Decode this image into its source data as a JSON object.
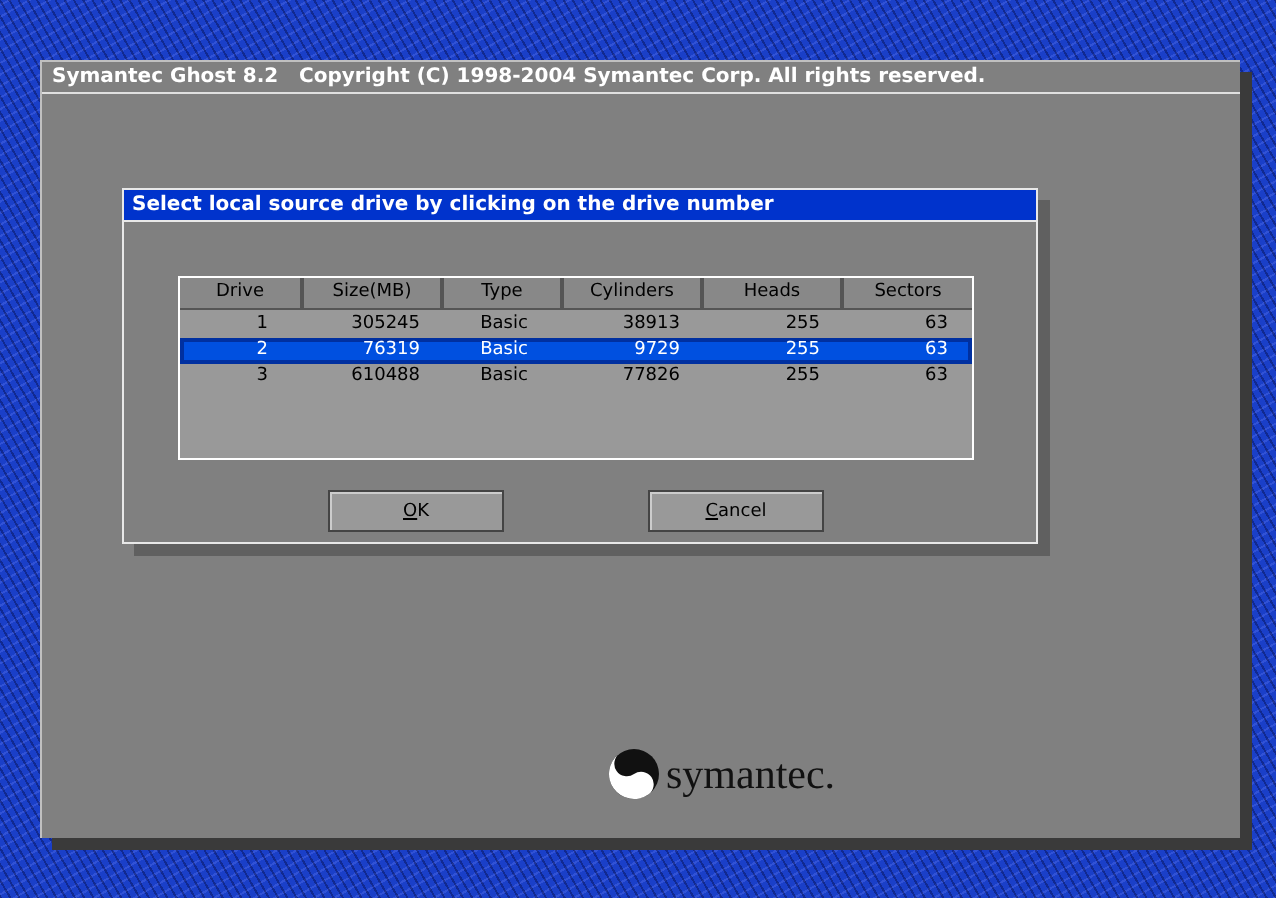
{
  "window": {
    "title": "Symantec Ghost 8.2   Copyright (C) 1998-2004 Symantec Corp. All rights reserved."
  },
  "dialog": {
    "title": "Select local source drive by clicking on the drive number",
    "table": {
      "columns": [
        "Drive",
        "Size(MB)",
        "Type",
        "Cylinders",
        "Heads",
        "Sectors"
      ],
      "rows": [
        {
          "cells": [
            "1",
            "305245",
            "Basic",
            "38913",
            "255",
            "63"
          ],
          "selected": false
        },
        {
          "cells": [
            "2",
            "76319",
            "Basic",
            "9729",
            "255",
            "63"
          ],
          "selected": true
        },
        {
          "cells": [
            "3",
            "610488",
            "Basic",
            "77826",
            "255",
            "63"
          ],
          "selected": false
        }
      ]
    },
    "buttons": [
      "OK",
      "Cancel"
    ]
  },
  "logo": {
    "text": "symantec."
  }
}
